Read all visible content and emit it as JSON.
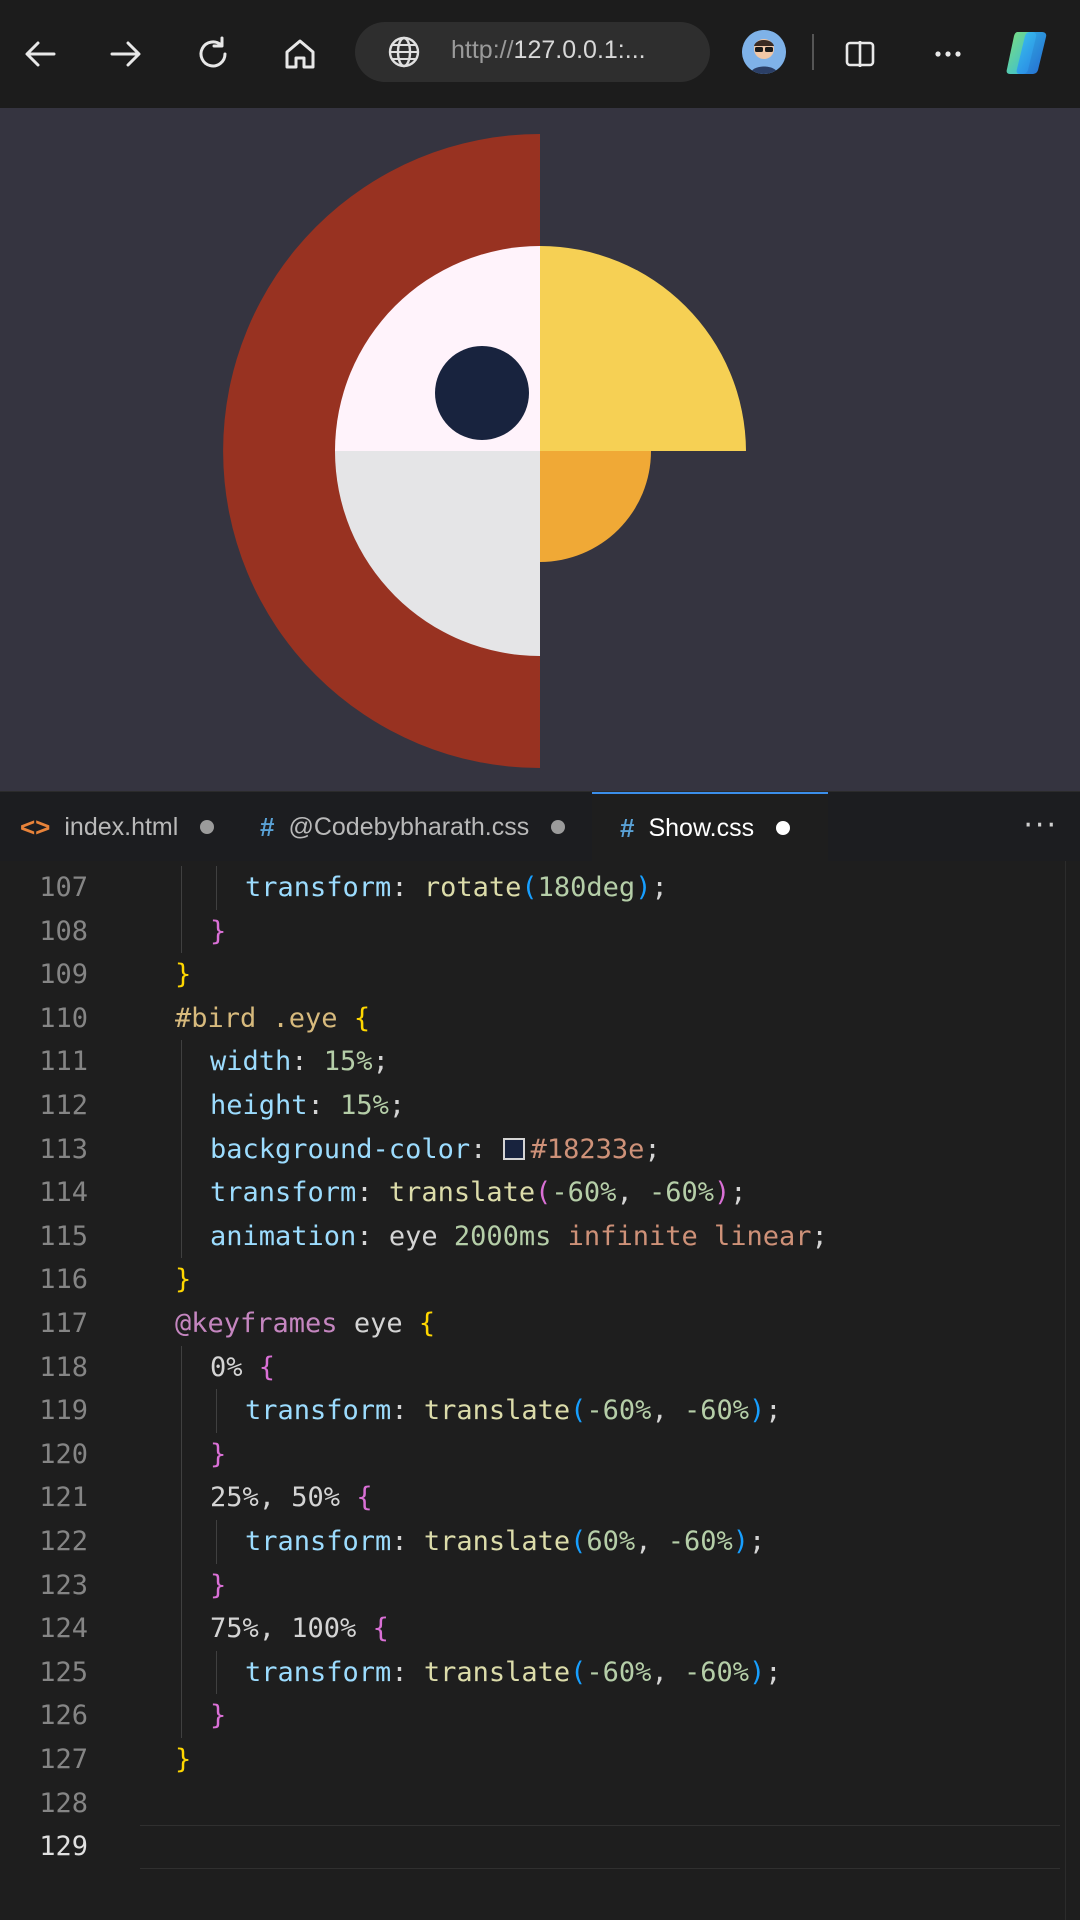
{
  "browser": {
    "url_scheme": "http://",
    "url_host": "127.0.0.1:...",
    "icons": [
      "back-arrow-icon",
      "forward-arrow-icon",
      "refresh-icon",
      "home-icon",
      "globe-icon",
      "profile-avatar",
      "split-screen-icon",
      "more-icon",
      "copilot-icon"
    ]
  },
  "preview": {
    "background": "#353440",
    "colors": {
      "outer_ring": "#983221",
      "face_top": "#fff3fb",
      "face_bottom": "#e5e5e7",
      "eye": "#18233e",
      "beak_top": "#f6d054",
      "beak_bottom": "#f0a936"
    }
  },
  "tabs": [
    {
      "icon": "<>",
      "label": "index.html",
      "active": false
    },
    {
      "icon": "#",
      "label": "@Codebybharath.css",
      "active": false
    },
    {
      "icon": "#",
      "label": "Show.css",
      "active": true
    }
  ],
  "tabs_more": "···",
  "code": {
    "line_numbers": [
      "107",
      "108",
      "109",
      "110",
      "111",
      "112",
      "113",
      "114",
      "115",
      "116",
      "117",
      "118",
      "119",
      "120",
      "121",
      "122",
      "123",
      "124",
      "125",
      "126",
      "127",
      "128",
      "129"
    ],
    "current_line": "129",
    "lines": [
      {
        "indent": 3,
        "tokens": [
          [
            "k-prop",
            "transform"
          ],
          [
            "k-plain",
            ": "
          ],
          [
            "k-fn",
            "rotate"
          ],
          [
            "b3",
            "("
          ],
          [
            "k-num",
            "180deg"
          ],
          [
            "b3",
            ")"
          ],
          [
            "k-plain",
            ";"
          ]
        ]
      },
      {
        "indent": 2,
        "tokens": [
          [
            "b2",
            "}"
          ]
        ]
      },
      {
        "indent": 1,
        "tokens": [
          [
            "b1",
            "}"
          ]
        ]
      },
      {
        "indent": 1,
        "tokens": [
          [
            "k-sel",
            "#bird .eye "
          ],
          [
            "b1",
            "{"
          ]
        ]
      },
      {
        "indent": 2,
        "tokens": [
          [
            "k-prop",
            "width"
          ],
          [
            "k-plain",
            ": "
          ],
          [
            "k-num",
            "15%"
          ],
          [
            "k-plain",
            ";"
          ]
        ]
      },
      {
        "indent": 2,
        "tokens": [
          [
            "k-prop",
            "height"
          ],
          [
            "k-plain",
            ": "
          ],
          [
            "k-num",
            "15%"
          ],
          [
            "k-plain",
            ";"
          ]
        ]
      },
      {
        "indent": 2,
        "swatch_after": 1,
        "tokens": [
          [
            "k-prop",
            "background-color"
          ],
          [
            "k-plain",
            ": "
          ],
          [
            "k-val",
            "#18233e"
          ],
          [
            "k-plain",
            ";"
          ]
        ]
      },
      {
        "indent": 2,
        "tokens": [
          [
            "k-prop",
            "transform"
          ],
          [
            "k-plain",
            ": "
          ],
          [
            "k-fn",
            "translate"
          ],
          [
            "b2",
            "("
          ],
          [
            "k-num",
            "-60%"
          ],
          [
            "k-plain",
            ", "
          ],
          [
            "k-num",
            "-60%"
          ],
          [
            "b2",
            ")"
          ],
          [
            "k-plain",
            ";"
          ]
        ]
      },
      {
        "indent": 2,
        "tokens": [
          [
            "k-prop",
            "animation"
          ],
          [
            "k-plain",
            ": eye "
          ],
          [
            "k-num",
            "2000ms"
          ],
          [
            "k-plain",
            " "
          ],
          [
            "k-val",
            "infinite linear"
          ],
          [
            "k-plain",
            ";"
          ]
        ]
      },
      {
        "indent": 1,
        "tokens": [
          [
            "b1",
            "}"
          ]
        ]
      },
      {
        "indent": 1,
        "tokens": [
          [
            "k-at",
            "@keyframes"
          ],
          [
            "k-plain",
            " eye "
          ],
          [
            "b1",
            "{"
          ]
        ]
      },
      {
        "indent": 2,
        "tokens": [
          [
            "k-plain",
            "0% "
          ],
          [
            "b2",
            "{"
          ]
        ]
      },
      {
        "indent": 3,
        "tokens": [
          [
            "k-prop",
            "transform"
          ],
          [
            "k-plain",
            ": "
          ],
          [
            "k-fn",
            "translate"
          ],
          [
            "b3",
            "("
          ],
          [
            "k-num",
            "-60%"
          ],
          [
            "k-plain",
            ", "
          ],
          [
            "k-num",
            "-60%"
          ],
          [
            "b3",
            ")"
          ],
          [
            "k-plain",
            ";"
          ]
        ]
      },
      {
        "indent": 2,
        "tokens": [
          [
            "b2",
            "}"
          ]
        ]
      },
      {
        "indent": 2,
        "tokens": [
          [
            "k-plain",
            "25%, 50% "
          ],
          [
            "b2",
            "{"
          ]
        ]
      },
      {
        "indent": 3,
        "tokens": [
          [
            "k-prop",
            "transform"
          ],
          [
            "k-plain",
            ": "
          ],
          [
            "k-fn",
            "translate"
          ],
          [
            "b3",
            "("
          ],
          [
            "k-num",
            "60%"
          ],
          [
            "k-plain",
            ", "
          ],
          [
            "k-num",
            "-60%"
          ],
          [
            "b3",
            ")"
          ],
          [
            "k-plain",
            ";"
          ]
        ]
      },
      {
        "indent": 2,
        "tokens": [
          [
            "b2",
            "}"
          ]
        ]
      },
      {
        "indent": 2,
        "tokens": [
          [
            "k-plain",
            "75%, 100% "
          ],
          [
            "b2",
            "{"
          ]
        ]
      },
      {
        "indent": 3,
        "tokens": [
          [
            "k-prop",
            "transform"
          ],
          [
            "k-plain",
            ": "
          ],
          [
            "k-fn",
            "translate"
          ],
          [
            "b3",
            "("
          ],
          [
            "k-num",
            "-60%"
          ],
          [
            "k-plain",
            ", "
          ],
          [
            "k-num",
            "-60%"
          ],
          [
            "b3",
            ")"
          ],
          [
            "k-plain",
            ";"
          ]
        ]
      },
      {
        "indent": 2,
        "tokens": [
          [
            "b2",
            "}"
          ]
        ]
      },
      {
        "indent": 1,
        "tokens": [
          [
            "b1",
            "}"
          ]
        ]
      },
      {
        "indent": 0,
        "tokens": []
      },
      {
        "indent": 0,
        "tokens": []
      }
    ]
  }
}
